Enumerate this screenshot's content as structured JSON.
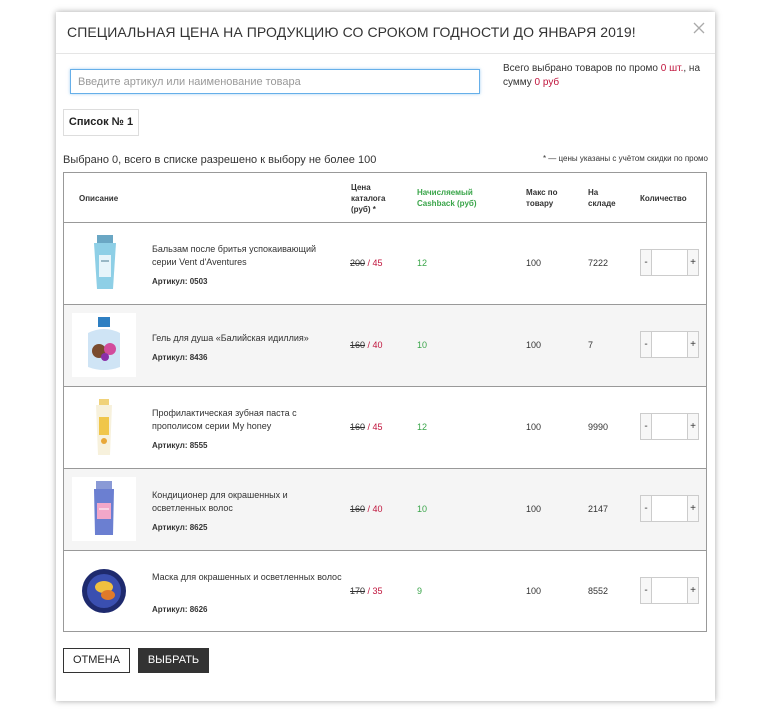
{
  "modal": {
    "title": "СПЕЦИАЛЬНАЯ ЦЕНА НА ПРОДУКЦИЮ СО СРОКОМ ГОДНОСТИ ДО ЯНВАРЯ 2019!",
    "close_icon": "close-icon"
  },
  "search": {
    "placeholder": "Введите артикул или наименование товара",
    "value": ""
  },
  "promo": {
    "prefix": "Всего выбрано товаров по промо ",
    "count": "0 шт.",
    "middle": ", на сумму ",
    "sum": "0 руб"
  },
  "list_tab": "Список № 1",
  "selected_info": "Выбрано 0, всего в списке разрешено к выбору не более 100",
  "price_note": "* — цены указаны с учётом скидки по промо",
  "headers": {
    "description": "Описание",
    "price_l1": "Цена",
    "price_l2": "каталога",
    "price_l3": "(руб) *",
    "cashback_l1": "Начисляемый",
    "cashback_l2": "Cashback (руб)",
    "max_l1": "Макс по",
    "max_l2": "товару",
    "stock_l1": "На",
    "stock_l2": "складе",
    "qty": "Количество"
  },
  "products": [
    {
      "name": "Бальзам после бритья успокаивающий серии Vent d'Aventures",
      "sku": "Артикул: 0503",
      "old_price": "200",
      "new_price": "45",
      "cashback": "12",
      "max": "100",
      "stock": "7222",
      "icon": "aftershave-bottle-icon",
      "qty": ""
    },
    {
      "name": "Гель для душа «Балийская идиллия»",
      "sku": "Артикул: 8436",
      "old_price": "160",
      "new_price": "40",
      "cashback": "10",
      "max": "100",
      "stock": "7",
      "icon": "shower-gel-bottle-icon",
      "qty": ""
    },
    {
      "name": "Профилактическая зубная паста с прополисом серии My honey",
      "sku": "Артикул: 8555",
      "old_price": "160",
      "new_price": "45",
      "cashback": "12",
      "max": "100",
      "stock": "9990",
      "icon": "toothpaste-tube-icon",
      "qty": ""
    },
    {
      "name": "Кондиционер для окрашенных и осветленных волос",
      "sku": "Артикул: 8625",
      "old_price": "160",
      "new_price": "40",
      "cashback": "10",
      "max": "100",
      "stock": "2147",
      "icon": "conditioner-bottle-icon",
      "qty": ""
    },
    {
      "name": "Маска для окрашенных и осветленных волос",
      "sku": "Артикул: 8626",
      "old_price": "170",
      "new_price": "35",
      "cashback": "9",
      "max": "100",
      "stock": "8552",
      "icon": "hair-mask-jar-icon",
      "qty": ""
    }
  ],
  "qty_controls": {
    "minus": "-",
    "plus": "+"
  },
  "buttons": {
    "cancel": "ОТМЕНА",
    "select": "ВЫБРАТЬ"
  },
  "colors": {
    "accent_red": "#c0143c",
    "cashback_green": "#3aa54a",
    "dark_button": "#333333"
  }
}
